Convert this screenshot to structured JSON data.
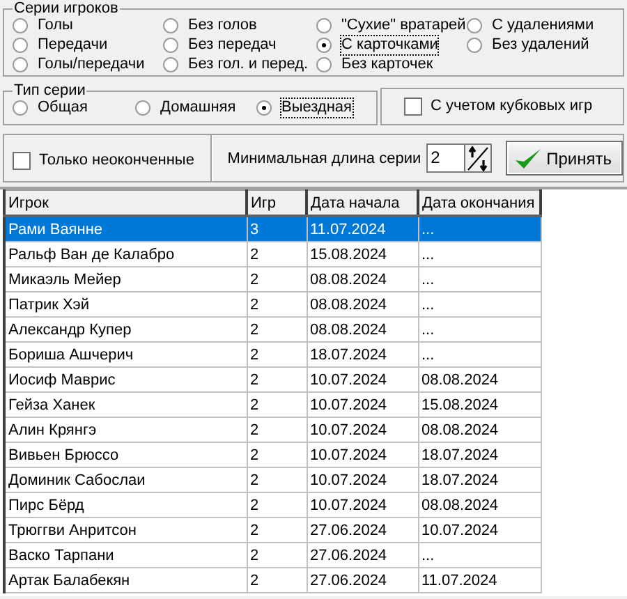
{
  "series_group": {
    "title": "Серии игроков",
    "options": [
      {
        "label": "Голы",
        "selected": false
      },
      {
        "label": "Без голов",
        "selected": false
      },
      {
        "label": "\"Сухие\" вратарей",
        "selected": false
      },
      {
        "label": "С удалениями",
        "selected": false
      },
      {
        "label": "Передачи",
        "selected": false
      },
      {
        "label": "Без передач",
        "selected": false
      },
      {
        "label": "С карточками",
        "selected": true
      },
      {
        "label": "Без удалений",
        "selected": false
      },
      {
        "label": "Голы/передачи",
        "selected": false
      },
      {
        "label": "Без гол. и перед.",
        "selected": false
      },
      {
        "label": "Без карточек",
        "selected": false
      }
    ]
  },
  "type_group": {
    "title": "Тип серии",
    "options": [
      {
        "label": "Общая",
        "selected": false
      },
      {
        "label": "Домашняя",
        "selected": false
      },
      {
        "label": "Выездная",
        "selected": true
      }
    ]
  },
  "cup_games": {
    "label": "С учетом кубковых игр",
    "checked": false
  },
  "unfinished_only": {
    "label": "Только неоконченные",
    "checked": false
  },
  "min_length": {
    "label": "Минимальная длина серии",
    "value": "2"
  },
  "apply_button": "Принять",
  "table": {
    "columns": [
      "Игрок",
      "Игр",
      "Дата начала",
      "Дата окончания"
    ],
    "rows": [
      {
        "cells": [
          "Рами Ваянне",
          "3",
          "11.07.2024",
          "..."
        ],
        "selected": true
      },
      {
        "cells": [
          "Ральф Ван де Калабро",
          "2",
          "15.08.2024",
          "..."
        ],
        "selected": false
      },
      {
        "cells": [
          "Микаэль Мейер",
          "2",
          "08.08.2024",
          "..."
        ],
        "selected": false
      },
      {
        "cells": [
          "Патрик Хэй",
          "2",
          "08.08.2024",
          "..."
        ],
        "selected": false
      },
      {
        "cells": [
          "Александр Купер",
          "2",
          "08.08.2024",
          "..."
        ],
        "selected": false
      },
      {
        "cells": [
          "Бориша Ашчерич",
          "2",
          "18.07.2024",
          "..."
        ],
        "selected": false
      },
      {
        "cells": [
          "Иосиф Маврис",
          "2",
          "10.07.2024",
          "08.08.2024"
        ],
        "selected": false
      },
      {
        "cells": [
          "Гейза Ханек",
          "2",
          "10.07.2024",
          "15.08.2024"
        ],
        "selected": false
      },
      {
        "cells": [
          "Алин Крянгэ",
          "2",
          "10.07.2024",
          "08.08.2024"
        ],
        "selected": false
      },
      {
        "cells": [
          "Вивьен Брюссо",
          "2",
          "10.07.2024",
          "18.07.2024"
        ],
        "selected": false
      },
      {
        "cells": [
          "Доминик Сабослаи",
          "2",
          "10.07.2024",
          "18.07.2024"
        ],
        "selected": false
      },
      {
        "cells": [
          "Пирс Бёрд",
          "2",
          "10.07.2024",
          "08.08.2024"
        ],
        "selected": false
      },
      {
        "cells": [
          "Трюггви Анритсон",
          "2",
          "27.06.2024",
          "10.07.2024"
        ],
        "selected": false
      },
      {
        "cells": [
          "Васко Тарпани",
          "2",
          "27.06.2024",
          "..."
        ],
        "selected": false
      },
      {
        "cells": [
          "Артак Балабекян",
          "2",
          "27.06.2024",
          "11.07.2024"
        ],
        "selected": false
      }
    ]
  }
}
